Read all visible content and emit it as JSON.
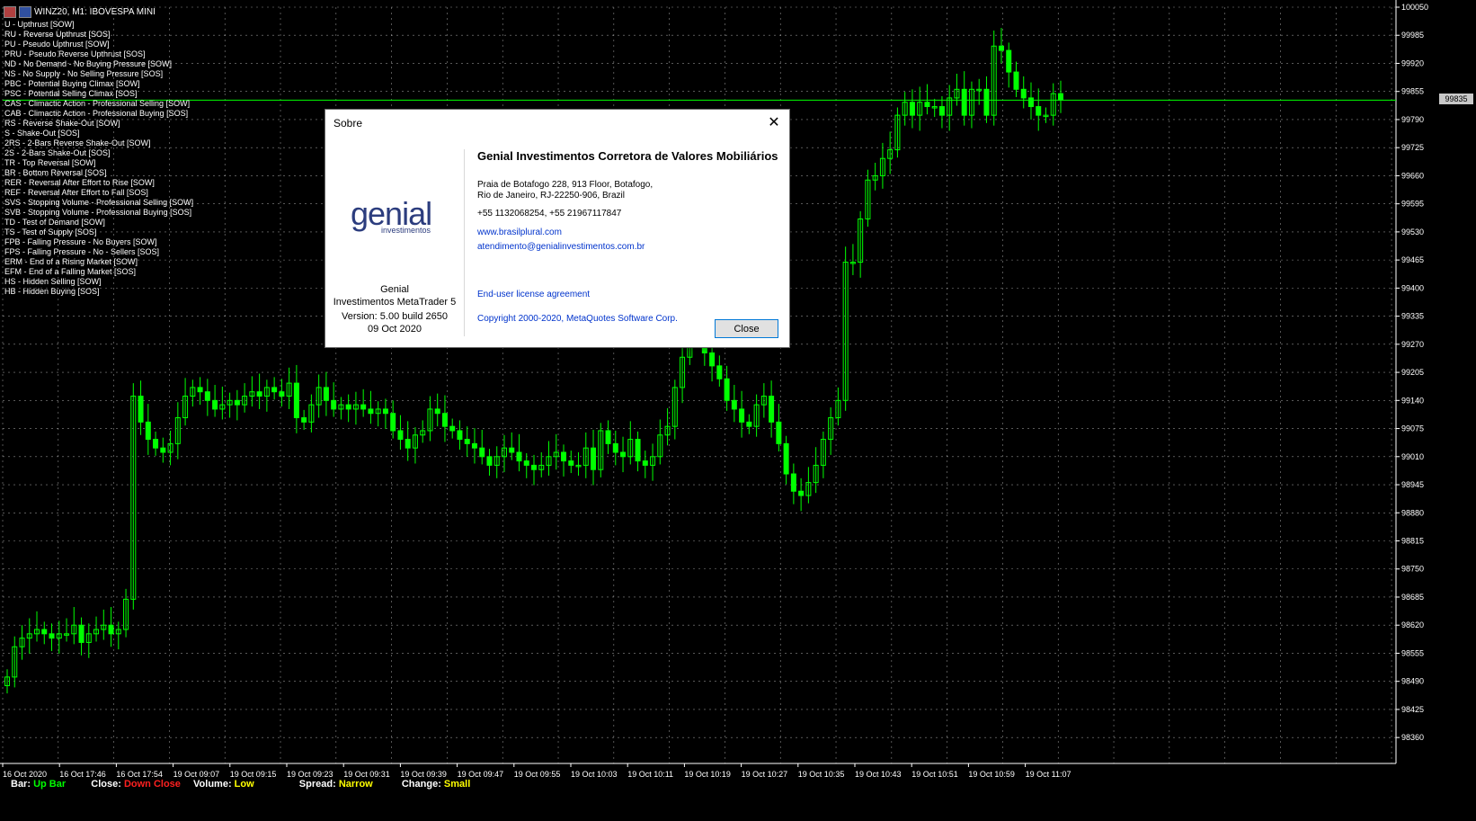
{
  "window": {
    "title": "WINZ20, M1:  IBOVESPA MINI"
  },
  "legend": [
    "U - Upthrust [SOW]",
    "RU - Reverse Upthrust [SOS]",
    "PU - Pseudo Upthrust [SOW]",
    "PRU - Pseudo Reverse Upthrust [SOS]",
    "ND - No Demand - No Buying Pressure [SOW]",
    "NS - No Supply - No Selling Pressure [SOS]",
    "PBC - Potential Buying Climax [SOW]",
    "PSC - Potential Selling Climax [SOS]",
    "CAS - Climactic Action - Professional Selling [SOW]",
    "CAB - Climactic Action - Professional Buying [SOS]",
    "RS - Reverse Shake-Out [SOW]",
    "S - Shake-Out [SOS]",
    "2RS - 2-Bars Reverse Shake-Out [SOW]",
    "2S - 2-Bars Shake-Out [SOS]",
    "TR - Top Reversal [SOW]",
    "BR - Bottom Reversal [SOS]",
    "RER - Reversal After Effort to Rise [SOW]",
    "REF - Reversal After Effort to Fall [SOS]",
    "SVS - Stopping Volume - Professional Selling [SOW]",
    "SVB - Stopping Volume - Professional Buying [SOS]",
    "TD - Test of Demand [SOW]",
    "TS - Test of Supply [SOS]",
    "FPB - Falling Pressure - No Buyers [SOW]",
    "FPS - Falling Pressure - No - Sellers [SOS]",
    "ERM - End of a Rising Market [SOW]",
    "EFM - End of a Falling Market [SOS]",
    "HS - Hidden Selling [SOW]",
    "HB - Hidden Buying [SOS]"
  ],
  "price_axis": [
    "100050",
    "99985",
    "99920",
    "99855",
    "99790",
    "99725",
    "99660",
    "99595",
    "99530",
    "99465",
    "99400",
    "99335",
    "99270",
    "99205",
    "99140",
    "99075",
    "99010",
    "98945",
    "98880",
    "98815",
    "98750",
    "98685",
    "98620",
    "98555",
    "98490",
    "98425",
    "98360"
  ],
  "current_price": "99835",
  "time_axis": [
    "16 Oct 2020",
    "16 Oct 17:46",
    "16 Oct 17:54",
    "19 Oct 09:07",
    "19 Oct 09:15",
    "19 Oct 09:23",
    "19 Oct 09:31",
    "19 Oct 09:39",
    "19 Oct 09:47",
    "19 Oct 09:55",
    "19 Oct 10:03",
    "19 Oct 10:11",
    "19 Oct 10:19",
    "19 Oct 10:27",
    "19 Oct 10:35",
    "19 Oct 10:43",
    "19 Oct 10:51",
    "19 Oct 10:59",
    "19 Oct 11:07"
  ],
  "status": {
    "bar_label": "Bar:",
    "bar_value": "Up Bar",
    "close_label": "Close:",
    "close_value": "Down Close",
    "volume_label": "Volume:",
    "volume_value": "Low",
    "spread_label": "Spread:",
    "spread_value": "Narrow",
    "change_label": "Change:",
    "change_value": "Small"
  },
  "colors": {
    "up": "#00ff00",
    "sow": "#ff66cc",
    "sos": "#00e5ff",
    "grid": "#ffffff",
    "status_green": "#00ff00",
    "status_red": "#ff2020",
    "status_yellow": "#ffff00"
  },
  "chart_data": {
    "type": "candlestick",
    "ylim": [
      98300,
      100050
    ],
    "close": [
      98500,
      98570,
      98590,
      98600,
      98610,
      98600,
      98590,
      98600,
      98600,
      98620,
      98580,
      98600,
      98610,
      98620,
      98600,
      98610,
      98680,
      99150,
      99090,
      99050,
      99030,
      99020,
      99040,
      99100,
      99150,
      99170,
      99160,
      99140,
      99120,
      99130,
      99140,
      99130,
      99150,
      99160,
      99150,
      99170,
      99160,
      99150,
      99180,
      99100,
      99090,
      99130,
      99170,
      99140,
      99120,
      99130,
      99120,
      99130,
      99120,
      99110,
      99120,
      99110,
      99070,
      99050,
      99030,
      99060,
      99070,
      99120,
      99110,
      99080,
      99070,
      99050,
      99040,
      99030,
      99010,
      98990,
      99010,
      99030,
      99020,
      99000,
      98990,
      98980,
      98990,
      99010,
      99020,
      99000,
      98990,
      98990,
      99030,
      98980,
      99070,
      99040,
      99020,
      99010,
      99050,
      99000,
      98990,
      99010,
      99060,
      99080,
      99170,
      99240,
      99290,
      99300,
      99250,
      99220,
      99190,
      99140,
      99120,
      99090,
      99080,
      99130,
      99150,
      99090,
      99040,
      98970,
      98930,
      98920,
      98950,
      98990,
      99050,
      99100,
      99140,
      99460,
      99460,
      99560,
      99650,
      99660,
      99700,
      99720,
      99800,
      99830,
      99800,
      99830,
      99820,
      99820,
      99800,
      99840,
      99860,
      99800,
      99860,
      99860,
      99800,
      99960,
      99950,
      99900,
      99860,
      99840,
      99820,
      99800,
      99800,
      99850,
      99835
    ]
  },
  "dialog": {
    "title": "Sobre",
    "logo_main": "genial",
    "logo_sub": "investimentos",
    "product_line1": "Genial",
    "product_line2": "Investimentos MetaTrader 5",
    "version_line": "Version: 5.00 build 2650",
    "date_line": "09 Oct 2020",
    "company": "Genial Investimentos Corretora de Valores Mobiliários S.A.",
    "address_line1": "Praia de Botafogo 228, 913 Floor, Botafogo,",
    "address_line2": "Rio de Janeiro, RJ-22250-906, Brazil",
    "phones": "+55 1132068254, +55 21967117847",
    "website": "www.brasilplural.com",
    "email": "atendimento@genialinvestimentos.com.br",
    "eula": "End-user license agreement",
    "copyright": "Copyright 2000-2020, MetaQuotes Software Corp.",
    "close_button": "Close"
  }
}
